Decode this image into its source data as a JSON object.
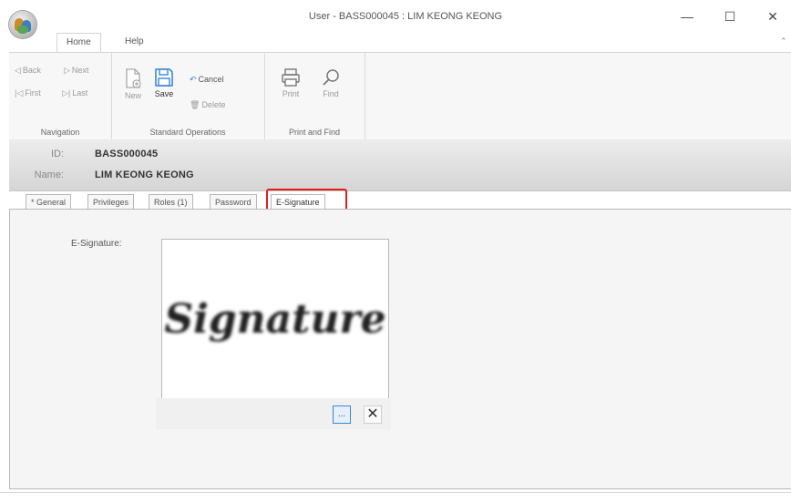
{
  "window": {
    "title": "User - BASS000045 : LIM KEONG KEONG",
    "minimize_glyph": "—",
    "maximize_glyph": "☐",
    "close_glyph": "✕",
    "collapse_glyph": "⌃"
  },
  "ribbon_tabs": [
    {
      "label": "Home",
      "selected": true
    },
    {
      "label": "Help",
      "selected": false
    }
  ],
  "ribbon": {
    "navigation": {
      "label": "Navigation",
      "back": "Back",
      "next": "Next",
      "first": "First",
      "last": "Last"
    },
    "standard": {
      "label": "Standard Operations",
      "new": "New",
      "save": "Save",
      "cancel": "Cancel",
      "delete": "Delete"
    },
    "print_find": {
      "label": "Print and Find",
      "print": "Print",
      "find": "Find"
    }
  },
  "record": {
    "id_label": "ID:",
    "id_value": "BASS000045",
    "name_label": "Name:",
    "name_value": "LIM KEONG KEONG"
  },
  "detail_tabs": [
    {
      "label": "* General",
      "selected": false
    },
    {
      "label": "Privileges",
      "selected": false
    },
    {
      "label": "Roles (1)",
      "selected": false
    },
    {
      "label": "Password",
      "selected": false
    },
    {
      "label": "E-Signature",
      "selected": true
    }
  ],
  "esignature": {
    "label": "E-Signature:",
    "signature_text": "Signature",
    "browse_glyph": "...",
    "clear_glyph": "✕"
  },
  "colors": {
    "highlight": "#e0201d",
    "accent": "#3c86d8"
  }
}
